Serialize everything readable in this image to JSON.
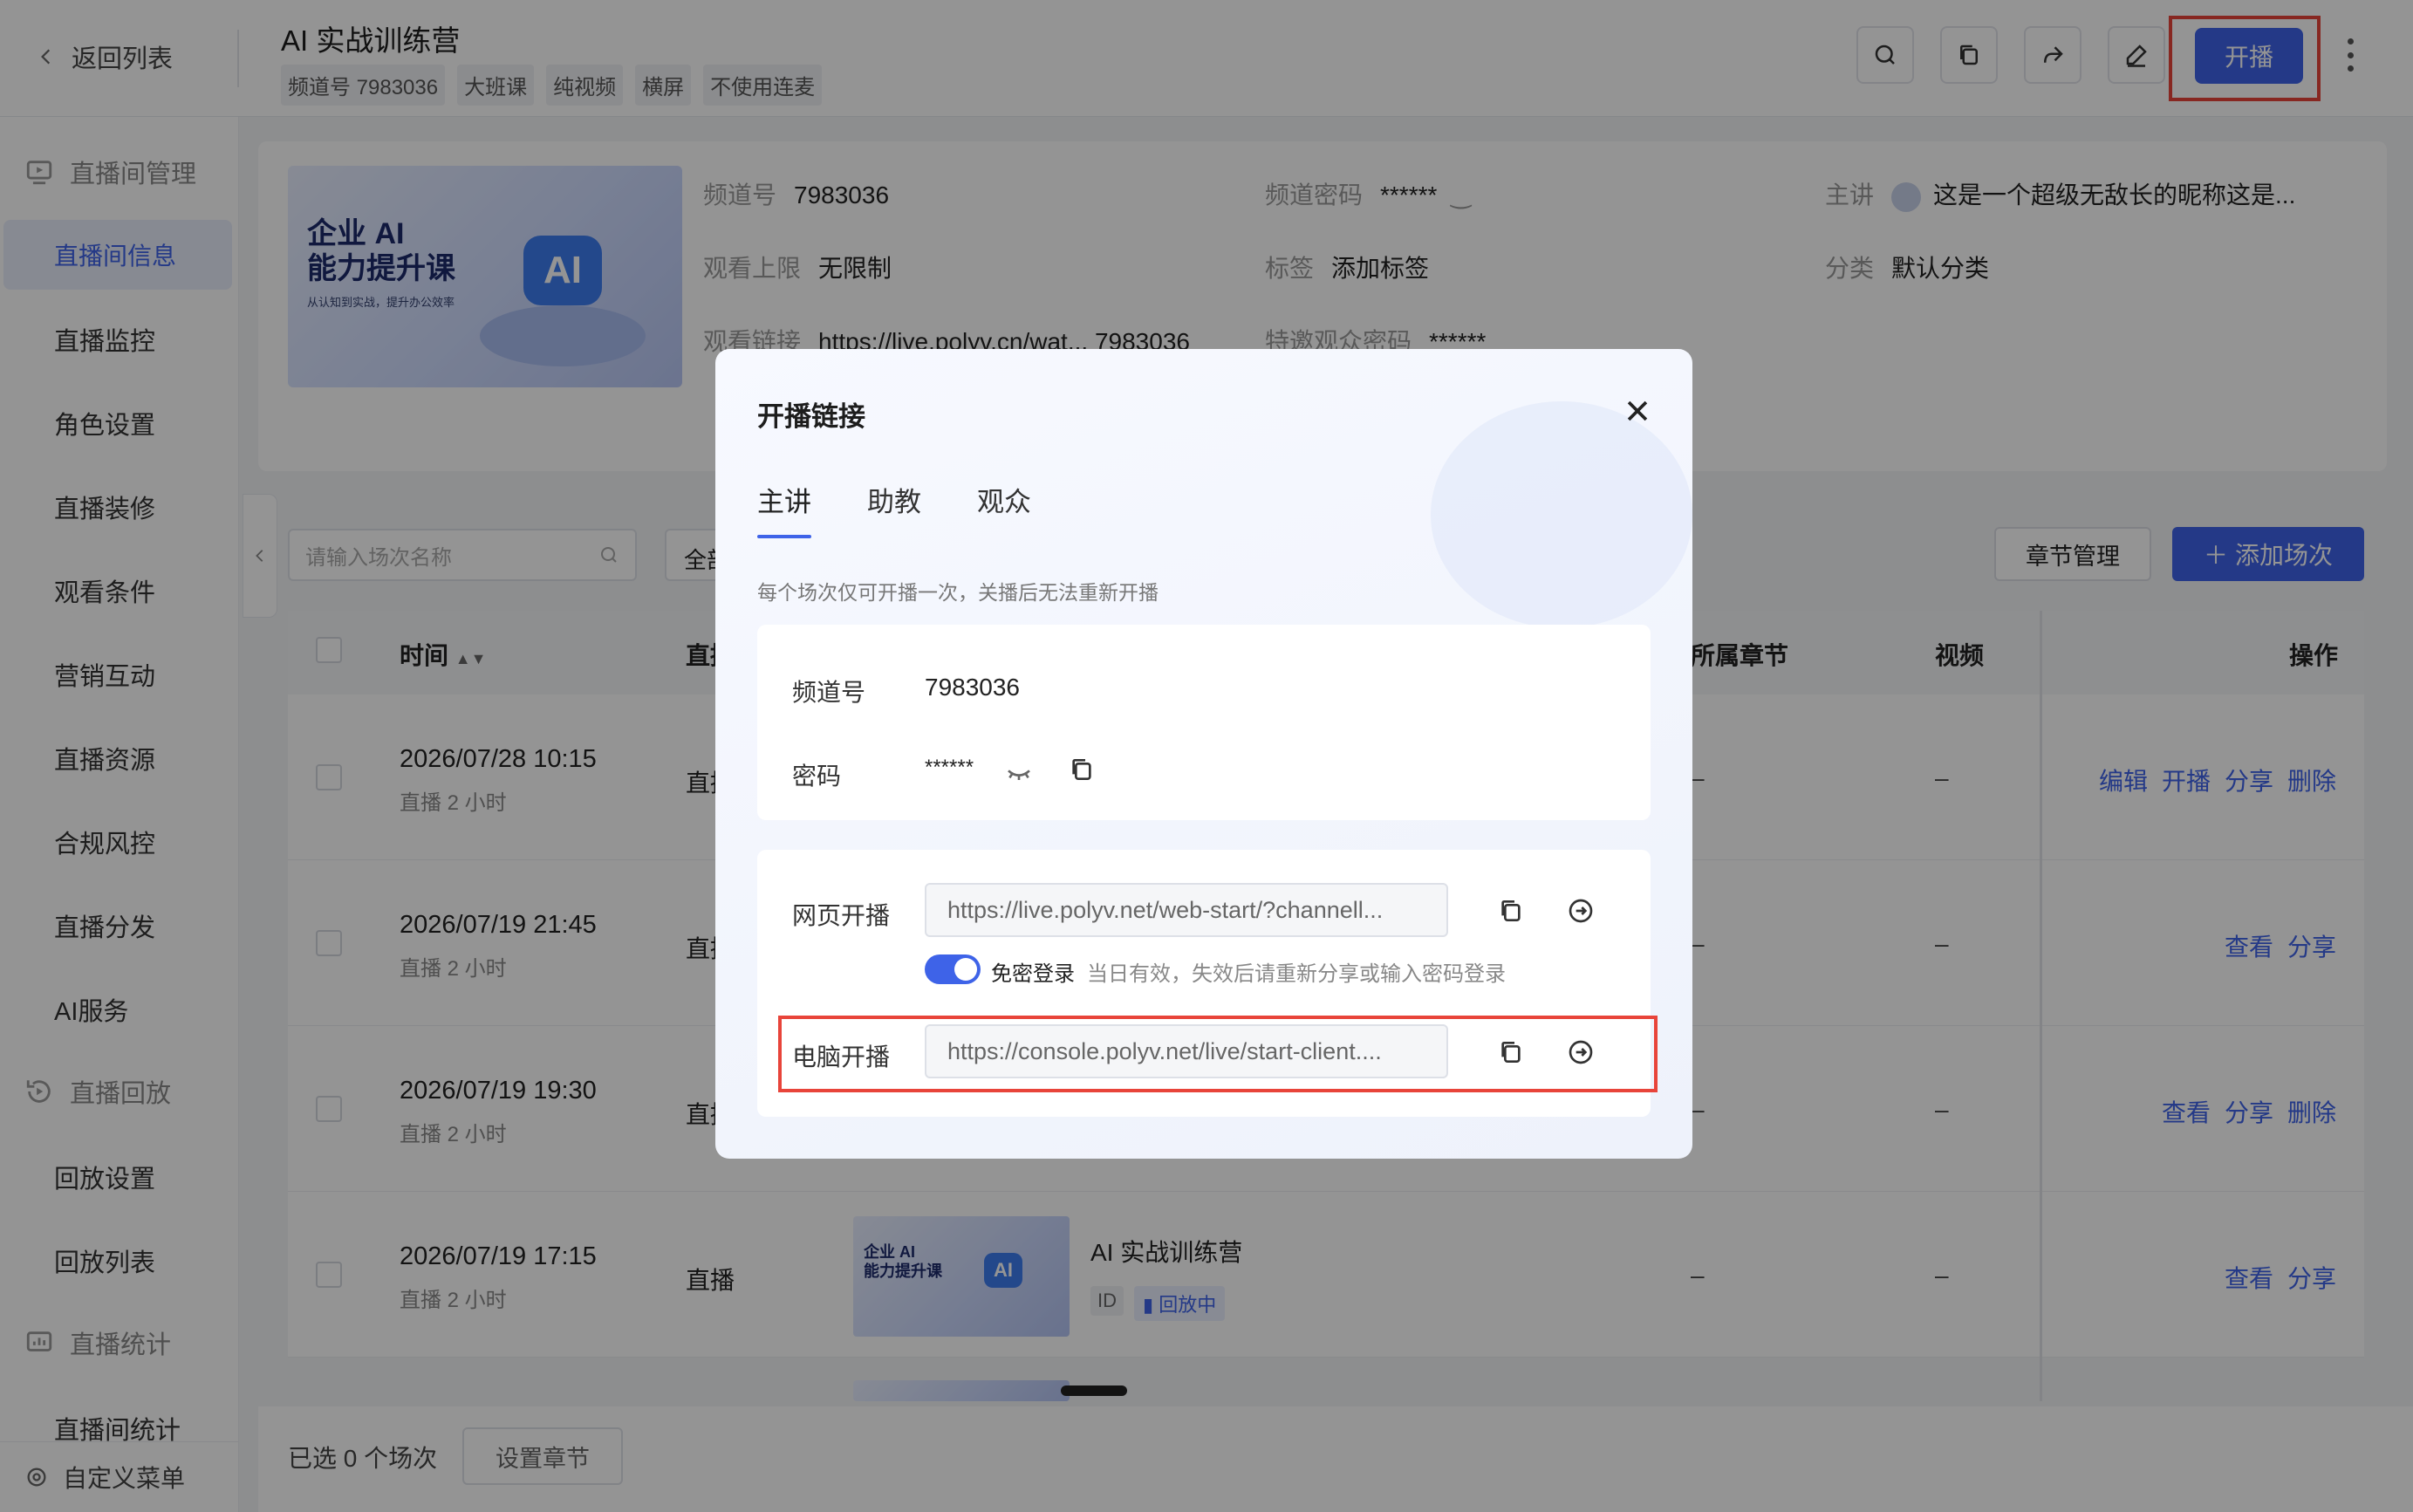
{
  "header": {
    "back_label": "返回列表",
    "title": "AI 实战训练营",
    "tags": [
      "频道号 7983036",
      "大班课",
      "纯视频",
      "横屏",
      "不使用连麦"
    ],
    "start_label": "开播"
  },
  "sidebar": {
    "groups": [
      {
        "label": "直播间管理",
        "icon": "live-room-icon"
      },
      {
        "label": "直播回放",
        "icon": "replay-icon"
      },
      {
        "label": "直播统计",
        "icon": "stats-icon"
      }
    ],
    "items": [
      "直播间信息",
      "直播监控",
      "角色设置",
      "直播装修",
      "观看条件",
      "营销互动",
      "直播资源",
      "合规风控",
      "直播分发",
      "AI服务",
      "回放设置",
      "回放列表",
      "直播间统计"
    ],
    "custom_menu": "自定义菜单"
  },
  "channel_info": {
    "cover_line1": "企业 AI",
    "cover_line2": "能力提升课",
    "cover_sub": "从认知到实战，提升办公效率",
    "cover_badge": "AI",
    "channel_no_label": "频道号",
    "channel_no": "7983036",
    "password_label": "频道密码",
    "password": "******",
    "host_label": "主讲",
    "host": "这是一个超级无敌长的昵称这是...",
    "limit_label": "观看上限",
    "limit": "无限制",
    "tags_label": "标签",
    "tags_value": "添加标签",
    "category_label": "分类",
    "category": "默认分类",
    "link_label": "观看链接",
    "link": "https://live.polyv.cn/wat... 7983036",
    "guest_pwd_label": "特邀观众密码",
    "guest_pwd": "******"
  },
  "toolbar": {
    "search_placeholder": "请输入场次名称",
    "all_label": "全部",
    "chapter_btn": "章节管理",
    "add_btn": "添加场次"
  },
  "table": {
    "headers": {
      "time": "时间",
      "type": "直播",
      "chapter": "所属章节",
      "video": "视频",
      "ops": "操作"
    },
    "rows": [
      {
        "time": "2026/07/28 10:15",
        "duration": "直播 2 小时",
        "type": "直播",
        "chapter": "–",
        "video": "–",
        "actions": [
          "编辑",
          "开播",
          "分享",
          "删除"
        ]
      },
      {
        "time": "2026/07/19 21:45",
        "duration": "直播 2 小时",
        "type": "直播",
        "chapter": "–",
        "video": "–",
        "actions": [
          "查看",
          "分享"
        ]
      },
      {
        "time": "2026/07/19 19:30",
        "duration": "直播 2 小时",
        "type": "直播",
        "chapter": "–",
        "video": "–",
        "actions": [
          "查看",
          "分享",
          "删除"
        ]
      },
      {
        "time": "2026/07/19 17:15",
        "duration": "直播 2 小时",
        "type": "直播",
        "name": "AI 实战训练营",
        "id_tag": "ID",
        "status_tag": "回放中",
        "chapter": "–",
        "video": "–",
        "actions": [
          "查看",
          "分享"
        ]
      }
    ]
  },
  "footer": {
    "selected": "已选 0 个场次",
    "set_chapter": "设置章节"
  },
  "modal": {
    "title": "开播链接",
    "tabs": [
      "主讲",
      "助教",
      "观众"
    ],
    "active_tab": "主讲",
    "note": "每个场次仅可开播一次，关播后无法重新开播",
    "channel_no_label": "频道号",
    "channel_no": "7983036",
    "password_label": "密码",
    "password": "******",
    "web_start_label": "网页开播",
    "web_start_url": "https://live.polyv.net/web-start/?channell...",
    "no_login_label": "免密登录",
    "no_login_on": true,
    "no_login_hint": "当日有效，失效后请重新分享或输入密码登录",
    "pc_start_label": "电脑开播",
    "pc_start_url": "https://console.polyv.net/live/start-client...."
  },
  "colors": {
    "accent": "#3e63e8",
    "highlight_box": "#e8443a"
  }
}
